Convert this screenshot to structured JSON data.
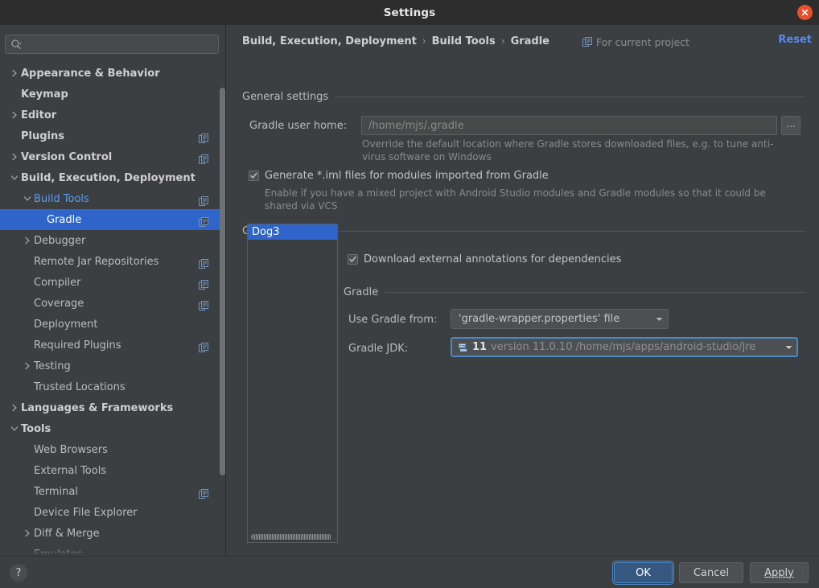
{
  "window": {
    "title": "Settings",
    "close_icon": "close-icon"
  },
  "colors": {
    "accent_blue": "#2f65ca",
    "link_blue": "#548af7",
    "tree_link": "#5a9bf0",
    "close_red": "#e8502a",
    "panel_bg": "#3c3f41",
    "titlebar_bg": "#2d2d2d",
    "focus_border": "#4a88c7"
  },
  "search": {
    "placeholder": "",
    "value": "",
    "icon": "search-icon"
  },
  "sidebar": {
    "items": [
      {
        "label": "Appearance & Behavior",
        "indent": 0,
        "arrow": "right",
        "bold": true,
        "badge": false,
        "selected": false,
        "link": false
      },
      {
        "label": "Keymap",
        "indent": 0,
        "arrow": "none",
        "bold": true,
        "badge": false,
        "selected": false,
        "link": false
      },
      {
        "label": "Editor",
        "indent": 0,
        "arrow": "right",
        "bold": true,
        "badge": false,
        "selected": false,
        "link": false
      },
      {
        "label": "Plugins",
        "indent": 0,
        "arrow": "none",
        "bold": true,
        "badge": true,
        "selected": false,
        "link": false
      },
      {
        "label": "Version Control",
        "indent": 0,
        "arrow": "right",
        "bold": true,
        "badge": true,
        "selected": false,
        "link": false
      },
      {
        "label": "Build, Execution, Deployment",
        "indent": 0,
        "arrow": "down",
        "bold": true,
        "badge": false,
        "selected": false,
        "link": false
      },
      {
        "label": "Build Tools",
        "indent": 1,
        "arrow": "down",
        "bold": false,
        "badge": true,
        "selected": false,
        "link": true
      },
      {
        "label": "Gradle",
        "indent": 2,
        "arrow": "none",
        "bold": false,
        "badge": true,
        "selected": true,
        "link": false
      },
      {
        "label": "Debugger",
        "indent": 1,
        "arrow": "right",
        "bold": false,
        "badge": false,
        "selected": false,
        "link": false
      },
      {
        "label": "Remote Jar Repositories",
        "indent": 1,
        "arrow": "none",
        "bold": false,
        "badge": true,
        "selected": false,
        "link": false
      },
      {
        "label": "Compiler",
        "indent": 1,
        "arrow": "none",
        "bold": false,
        "badge": true,
        "selected": false,
        "link": false
      },
      {
        "label": "Coverage",
        "indent": 1,
        "arrow": "none",
        "bold": false,
        "badge": true,
        "selected": false,
        "link": false
      },
      {
        "label": "Deployment",
        "indent": 1,
        "arrow": "none",
        "bold": false,
        "badge": false,
        "selected": false,
        "link": false
      },
      {
        "label": "Required Plugins",
        "indent": 1,
        "arrow": "none",
        "bold": false,
        "badge": true,
        "selected": false,
        "link": false
      },
      {
        "label": "Testing",
        "indent": 1,
        "arrow": "right",
        "bold": false,
        "badge": false,
        "selected": false,
        "link": false
      },
      {
        "label": "Trusted Locations",
        "indent": 1,
        "arrow": "none",
        "bold": false,
        "badge": false,
        "selected": false,
        "link": false
      },
      {
        "label": "Languages & Frameworks",
        "indent": 0,
        "arrow": "right",
        "bold": true,
        "badge": false,
        "selected": false,
        "link": false
      },
      {
        "label": "Tools",
        "indent": 0,
        "arrow": "down",
        "bold": true,
        "badge": false,
        "selected": false,
        "link": false
      },
      {
        "label": "Web Browsers",
        "indent": 1,
        "arrow": "none",
        "bold": false,
        "badge": false,
        "selected": false,
        "link": false
      },
      {
        "label": "External Tools",
        "indent": 1,
        "arrow": "none",
        "bold": false,
        "badge": false,
        "selected": false,
        "link": false
      },
      {
        "label": "Terminal",
        "indent": 1,
        "arrow": "none",
        "bold": false,
        "badge": true,
        "selected": false,
        "link": false
      },
      {
        "label": "Device File Explorer",
        "indent": 1,
        "arrow": "none",
        "bold": false,
        "badge": false,
        "selected": false,
        "link": false
      },
      {
        "label": "Diff & Merge",
        "indent": 1,
        "arrow": "right",
        "bold": false,
        "badge": false,
        "selected": false,
        "link": false
      },
      {
        "label": "Emulates",
        "indent": 1,
        "arrow": "none",
        "bold": false,
        "badge": false,
        "selected": false,
        "link": false
      }
    ]
  },
  "breadcrumb": {
    "items": [
      "Build, Execution, Deployment",
      "Build Tools",
      "Gradle"
    ],
    "separator": "›",
    "scope_label": "For current project",
    "scope_icon": "project-scope-icon",
    "reset_label": "Reset"
  },
  "general": {
    "section_label": "General settings",
    "gradle_home_label": "Gradle user home:",
    "gradle_home_value": "",
    "gradle_home_placeholder": "/home/mjs/.gradle",
    "browse_label": "...",
    "gradle_home_help": "Override the default location where Gradle stores downloaded files, e.g. to tune anti-virus software on Windows",
    "iml_checkbox_label": "Generate *.iml files for modules imported from Gradle",
    "iml_checked": true,
    "iml_help": "Enable if you have a mixed project with Android Studio modules and Gradle modules so that it could be shared via VCS"
  },
  "projects": {
    "section_label": "Gradle projects",
    "list": [
      "Dog3"
    ],
    "selected_index": 0,
    "download_annotations_label": "Download external annotations for dependencies",
    "download_annotations_checked": true
  },
  "gradle": {
    "section_label": "Gradle",
    "use_gradle_from_label": "Use Gradle from:",
    "use_gradle_from_value": "'gradle-wrapper.properties' file",
    "jdk_label": "Gradle JDK:",
    "jdk_icon": "jdk-icon",
    "jdk_version": "11",
    "jdk_detail": "version 11.0.10 /home/mjs/apps/android-studio/jre",
    "dropdown_icon": "chevron-down-icon"
  },
  "footer": {
    "help_label": "?",
    "ok_label": "OK",
    "cancel_label": "Cancel",
    "apply_label": "Apply"
  }
}
